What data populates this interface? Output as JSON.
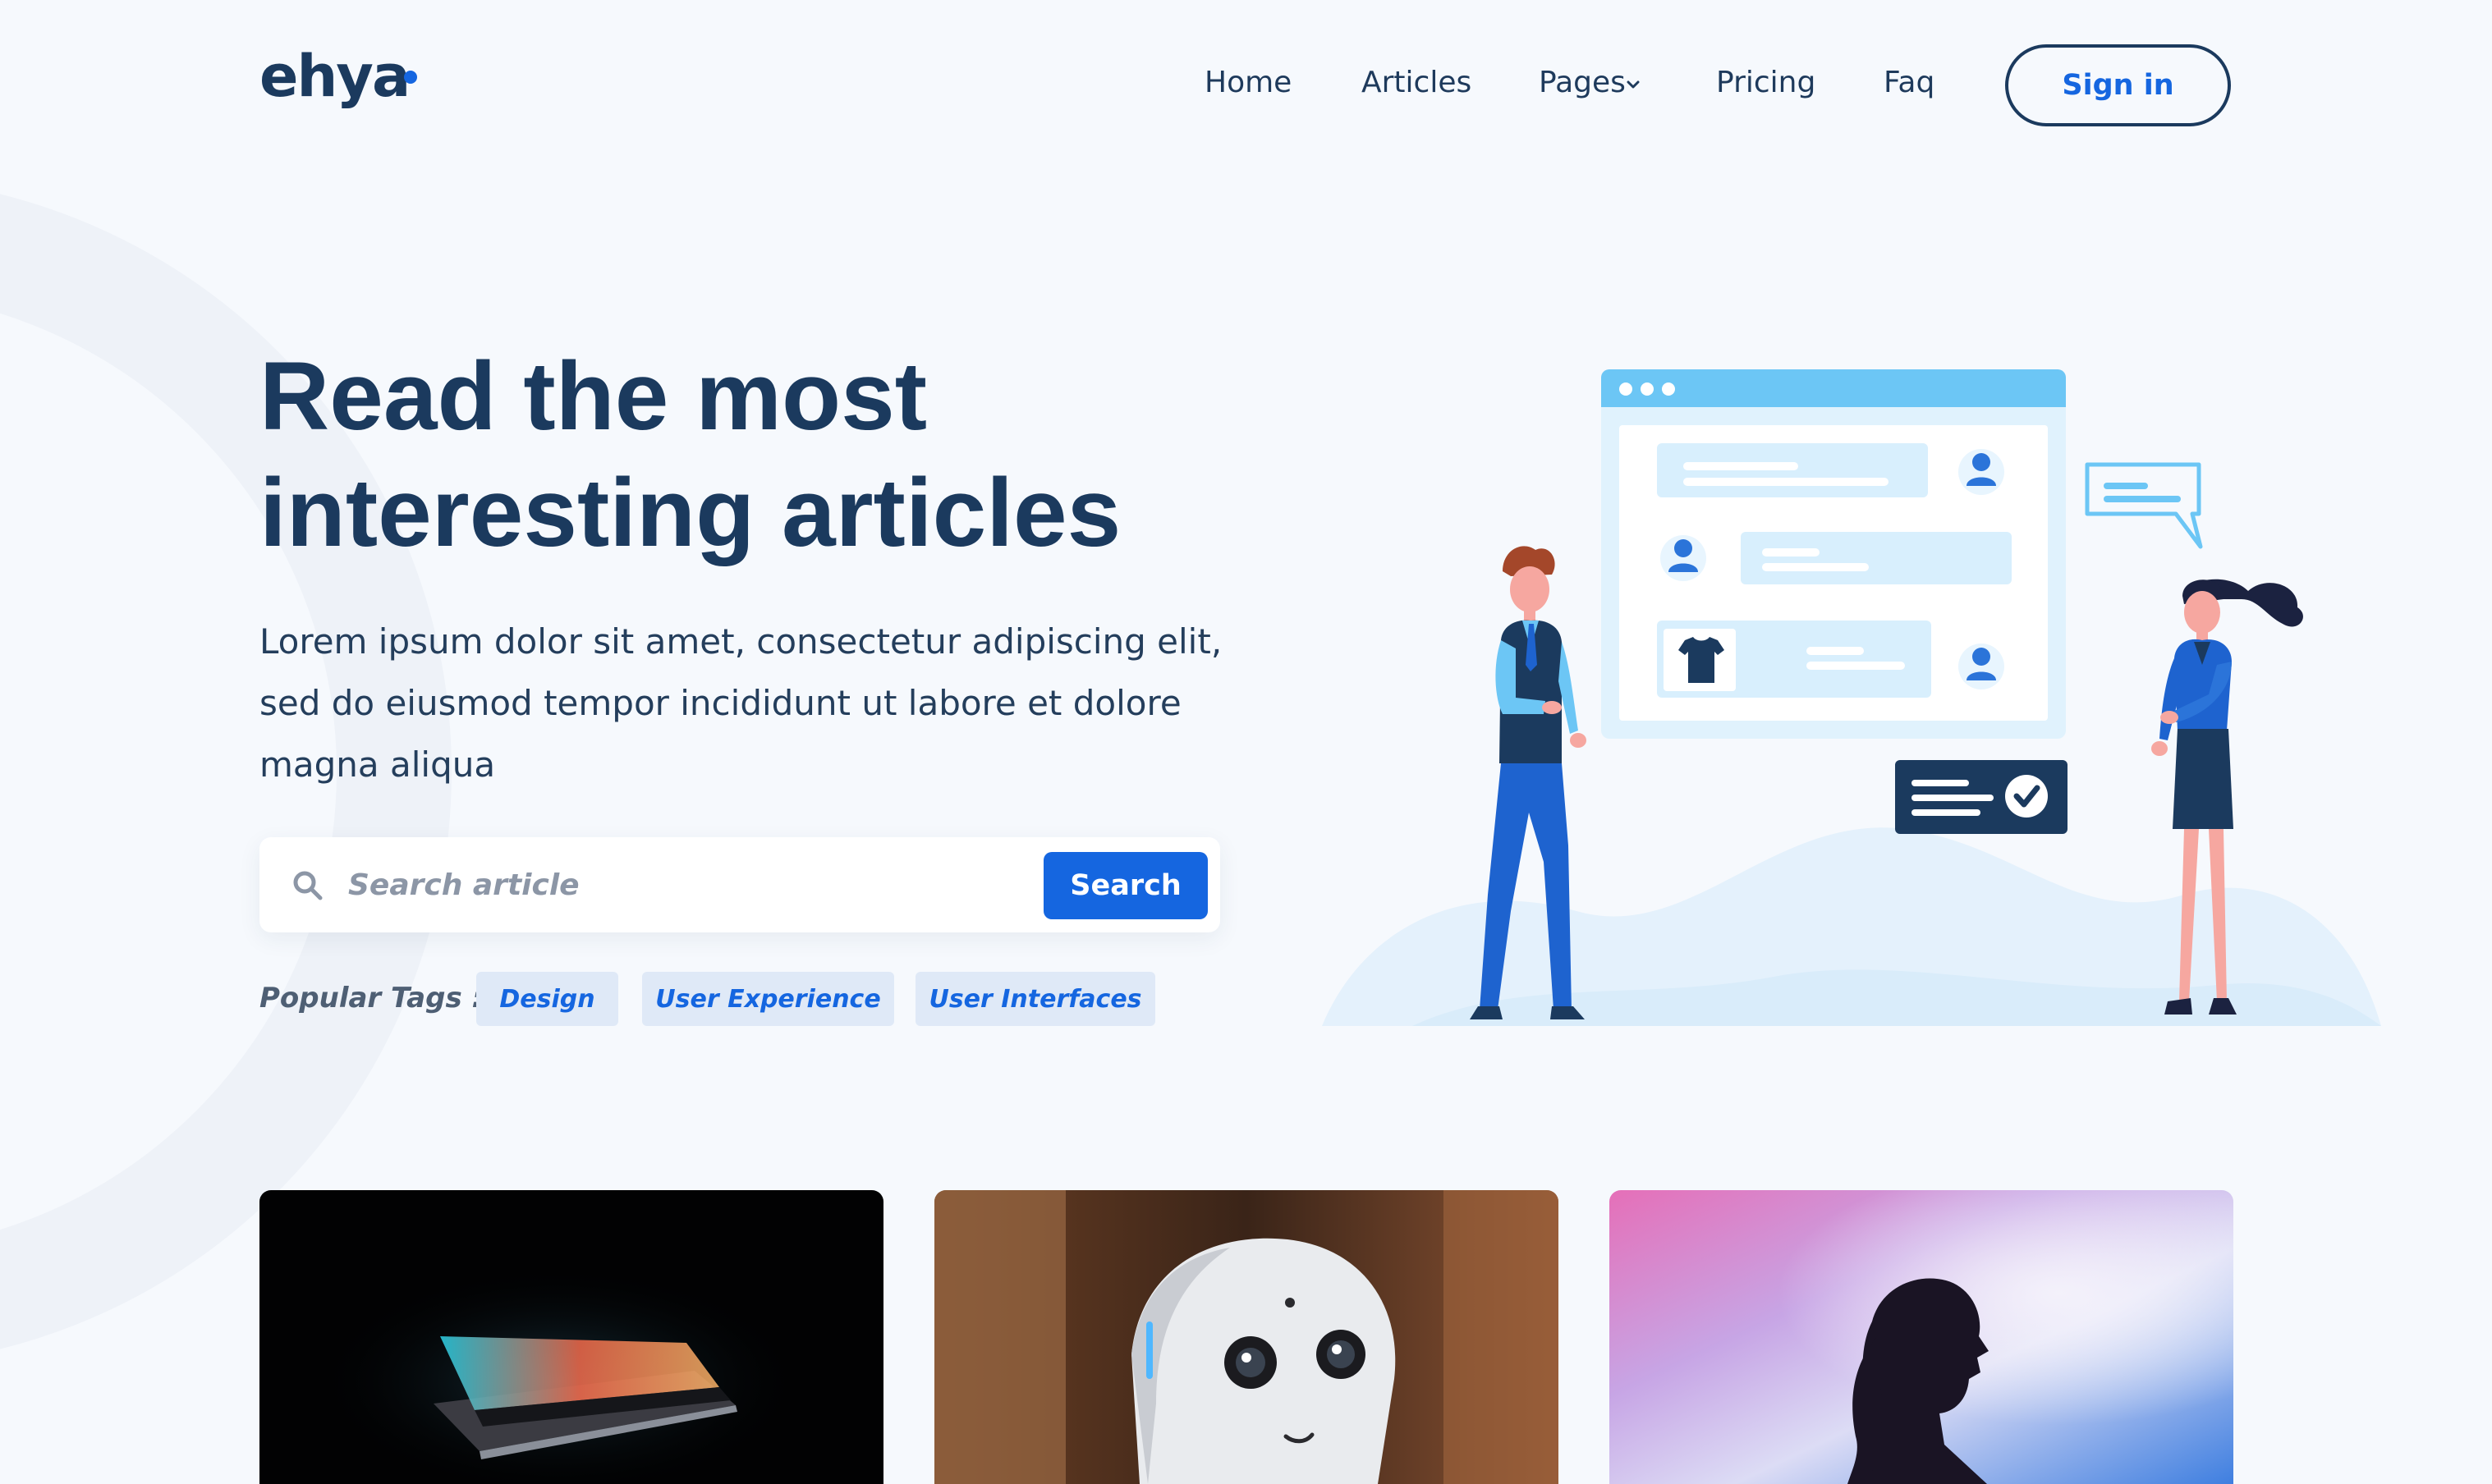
{
  "brand": {
    "logo": "ehya",
    "accent": "#1566e0",
    "dark": "#1b3a5e"
  },
  "nav": {
    "items": [
      {
        "label": "Home"
      },
      {
        "label": "Articles"
      },
      {
        "label": "Pages",
        "has_dropdown": true
      },
      {
        "label": "Pricing"
      },
      {
        "label": "Faq"
      }
    ],
    "sign_in_label": "Sign in"
  },
  "hero": {
    "title_lines": [
      "Read the most",
      "interesting articles"
    ],
    "description_lines": [
      "Lorem ipsum dolor sit amet, consectetur adipiscing elit,",
      "sed do eiusmod tempor incididunt ut labore et dolore",
      "magna aliqua"
    ],
    "search": {
      "placeholder": "Search article",
      "value": "",
      "button_label": "Search",
      "icon": "search-icon"
    },
    "popular_tags_label": "Popular Tags :",
    "tags": [
      "Design",
      "User Experience",
      "User Interfaces"
    ]
  },
  "illustration": {
    "description_icons": [
      "chat-illustration",
      "shirt-icon",
      "user-icon",
      "check-icon"
    ],
    "colors": {
      "light_blue": "#6cc6f5",
      "panel": "#e0f2fd",
      "navy": "#1b3a5e",
      "blue": "#1e63cf"
    }
  },
  "cards": [
    {
      "image": "laptop-photo"
    },
    {
      "image": "robot-photo"
    },
    {
      "image": "woman-silhouette-photo"
    }
  ]
}
